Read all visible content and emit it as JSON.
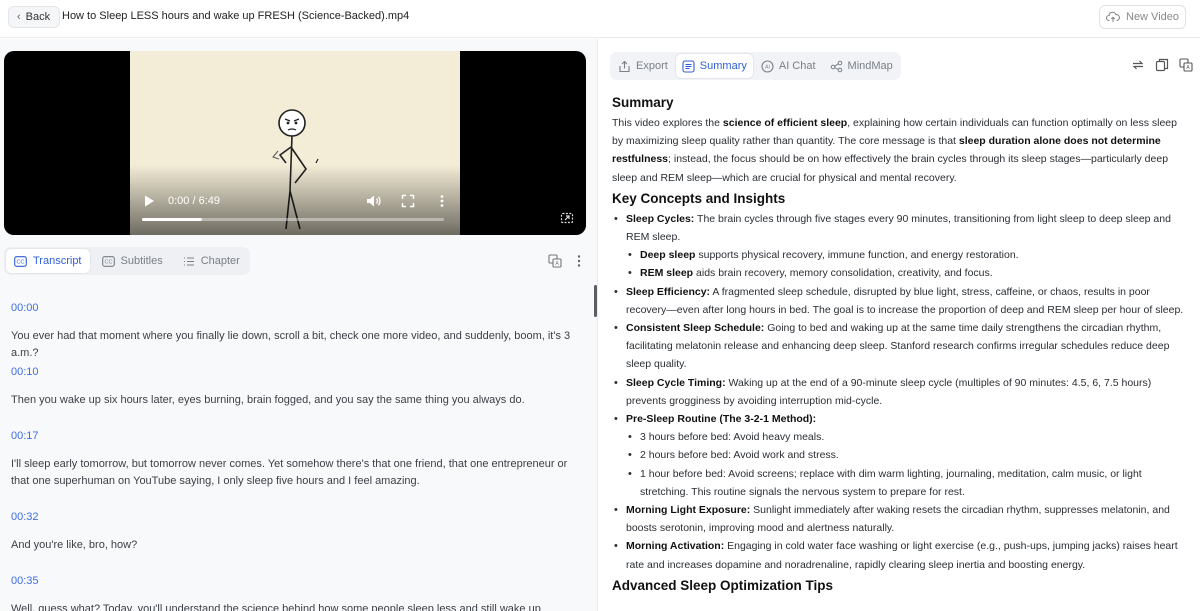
{
  "header": {
    "back_label": "Back",
    "file_title": "How to Sleep LESS hours and wake up FRESH (Science-Backed).mp4",
    "new_video_label": "New Video"
  },
  "video": {
    "time": "0:00 / 6:49",
    "progress": 0.2
  },
  "left_tabs": [
    {
      "label": "Transcript",
      "icon": "cc-icon"
    },
    {
      "label": "Subtitles",
      "icon": "cc-icon"
    },
    {
      "label": "Chapter",
      "icon": "list-icon"
    }
  ],
  "transcript": [
    {
      "time": "00:00",
      "text": "You ever had that moment where you finally lie down, scroll a bit, check one more video, and suddenly, boom, it's 3 a.m.?"
    },
    {
      "time": "00:10",
      "text": "Then you wake up six hours later, eyes burning, brain fogged, and you say the same thing you always do."
    },
    {
      "time": "00:17",
      "text": "I'll sleep early tomorrow, but tomorrow never comes. Yet somehow there's that one friend, that one entrepreneur or that one superhuman on YouTube saying, I only sleep five hours and I feel amazing."
    },
    {
      "time": "00:32",
      "text": "And you're like, bro, how?"
    },
    {
      "time": "00:35",
      "text": "Well, guess what? Today, you'll understand the science behind how some people sleep less and still wake up feeling fresh,"
    }
  ],
  "right_tabs": [
    {
      "label": "Export",
      "icon": "export-icon"
    },
    {
      "label": "Summary",
      "icon": "summary-icon"
    },
    {
      "label": "AI Chat",
      "icon": "ai-icon"
    },
    {
      "label": "MindMap",
      "icon": "mindmap-icon"
    }
  ],
  "summary": {
    "heading": "Summary",
    "intro": {
      "t1": "This video explores the ",
      "b1": "science of efficient sleep",
      "t2": ", explaining how certain individuals can function optimally on less sleep by maximizing sleep quality rather than quantity. The core message is that ",
      "b2": "sleep duration alone does not determine restfulness",
      "t3": "; instead, the focus should be on how effectively the brain cycles through its sleep stages—particularly deep sleep and REM sleep—which are crucial for physical and mental recovery."
    },
    "key_heading": "Key Concepts and Insights",
    "cycles": {
      "title": "Sleep Cycles:",
      "text": " The brain cycles through five stages every 90 minutes, transitioning from light sleep to deep sleep and REM sleep.",
      "deep_title": "Deep sleep",
      "deep_text": " supports physical recovery, immune function, and energy restoration.",
      "rem_title": "REM sleep",
      "rem_text": " aids brain recovery, memory consolidation, creativity, and focus."
    },
    "efficiency": {
      "title": "Sleep Efficiency:",
      "text": " A fragmented sleep schedule, disrupted by blue light, stress, caffeine, or chaos, results in poor recovery—even after long hours in bed. The goal is to increase the proportion of deep and REM sleep per hour of sleep."
    },
    "consistent": {
      "title": "Consistent Sleep Schedule:",
      "text": " Going to bed and waking up at the same time daily strengthens the circadian rhythm, facilitating melatonin release and enhancing deep sleep. Stanford research confirms irregular schedules reduce deep sleep quality."
    },
    "timing": {
      "title": "Sleep Cycle Timing:",
      "text": " Waking up at the end of a 90-minute sleep cycle (multiples of 90 minutes: 4.5, 6, 7.5 hours) prevents grogginess by avoiding interruption mid-cycle."
    },
    "routine": {
      "title": "Pre-Sleep Routine (The 3-2-1 Method):",
      "items": [
        "3 hours before bed: Avoid heavy meals.",
        "2 hours before bed: Avoid work and stress.",
        "1 hour before bed: Avoid screens; replace with dim warm lighting, journaling, meditation, calm music, or light stretching. This routine signals the nervous system to prepare for rest."
      ]
    },
    "morning_light": {
      "title": "Morning Light Exposure:",
      "text": " Sunlight immediately after waking resets the circadian rhythm, suppresses melatonin, and boosts serotonin, improving mood and alertness naturally."
    },
    "activation": {
      "title": "Morning Activation:",
      "text": " Engaging in cold water face washing or light exercise (e.g., push-ups, jumping jacks) raises heart rate and increases dopamine and noradrenaline, rapidly clearing sleep inertia and boosting energy."
    },
    "advanced_heading": "Advanced Sleep Optimization Tips"
  },
  "colors": {
    "accent": "#2f5fd6",
    "timestamp": "#3f6ee0",
    "video_bg": "#f3ecd6"
  }
}
